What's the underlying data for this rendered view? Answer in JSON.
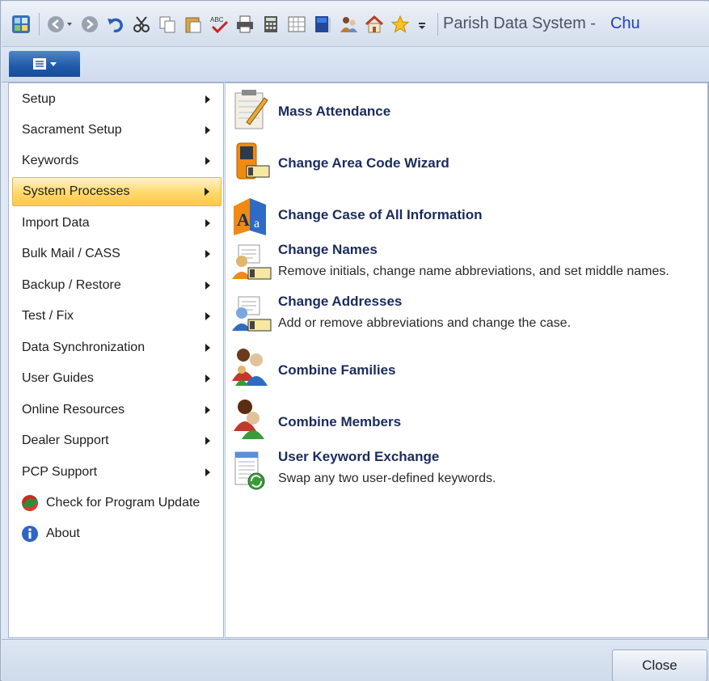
{
  "window": {
    "title": "Parish Data System -",
    "app_name": "Chu"
  },
  "qat_icons": [
    "app-icon",
    "back-icon",
    "forward-icon",
    "undo-icon",
    "cut-icon",
    "copy-icon",
    "paste-icon",
    "spellcheck-icon",
    "print-icon",
    "calculator-icon",
    "calendar-icon",
    "book-icon",
    "people-icon",
    "home-icon",
    "star-icon",
    "customize-icon"
  ],
  "ribbon": {
    "app_button_icon": "application-menu-icon"
  },
  "left_menu": {
    "items": [
      {
        "label": "Setup",
        "has_submenu": true
      },
      {
        "label": "Sacrament Setup",
        "has_submenu": true
      },
      {
        "label": "Keywords",
        "has_submenu": true
      },
      {
        "label": "System Processes",
        "has_submenu": true,
        "active": true
      },
      {
        "label": "Import Data",
        "has_submenu": true
      },
      {
        "label": "Bulk Mail / CASS",
        "has_submenu": true
      },
      {
        "label": "Backup / Restore",
        "has_submenu": true
      },
      {
        "label": "Test / Fix",
        "has_submenu": true
      },
      {
        "label": "Data Synchronization",
        "has_submenu": true
      },
      {
        "label": "User Guides",
        "has_submenu": true
      },
      {
        "label": "Online Resources",
        "has_submenu": true
      },
      {
        "label": "Dealer Support",
        "has_submenu": true
      },
      {
        "label": "PCP Support",
        "has_submenu": true
      },
      {
        "label": "Check for Program Update",
        "icon": "update-icon"
      },
      {
        "label": "About",
        "icon": "info-icon"
      }
    ]
  },
  "actions": [
    {
      "title": "Mass Attendance",
      "desc": "",
      "icon": "notepad-icon"
    },
    {
      "title": "Change Area Code Wizard",
      "desc": "",
      "icon": "phone-icon"
    },
    {
      "title": "Change Case of All Information",
      "desc": "",
      "icon": "text-case-icon"
    },
    {
      "title": "Change Names",
      "desc": "Remove initials, change name abbreviations, and set middle names.",
      "icon": "names-icon"
    },
    {
      "title": "Change Addresses",
      "desc": "Add or remove abbreviations and change the case.",
      "icon": "addresses-icon"
    },
    {
      "title": "Combine Families",
      "desc": "",
      "icon": "families-icon"
    },
    {
      "title": "Combine Members",
      "desc": "",
      "icon": "members-icon"
    },
    {
      "title": "User Keyword Exchange",
      "desc": "Swap any two user-defined keywords.",
      "icon": "keyword-exchange-icon"
    }
  ],
  "footer": {
    "close_label": "Close"
  },
  "colors": {
    "accent": "#1f5aa8",
    "active_item": "#ffd86b",
    "action_title": "#1b2b5e"
  }
}
